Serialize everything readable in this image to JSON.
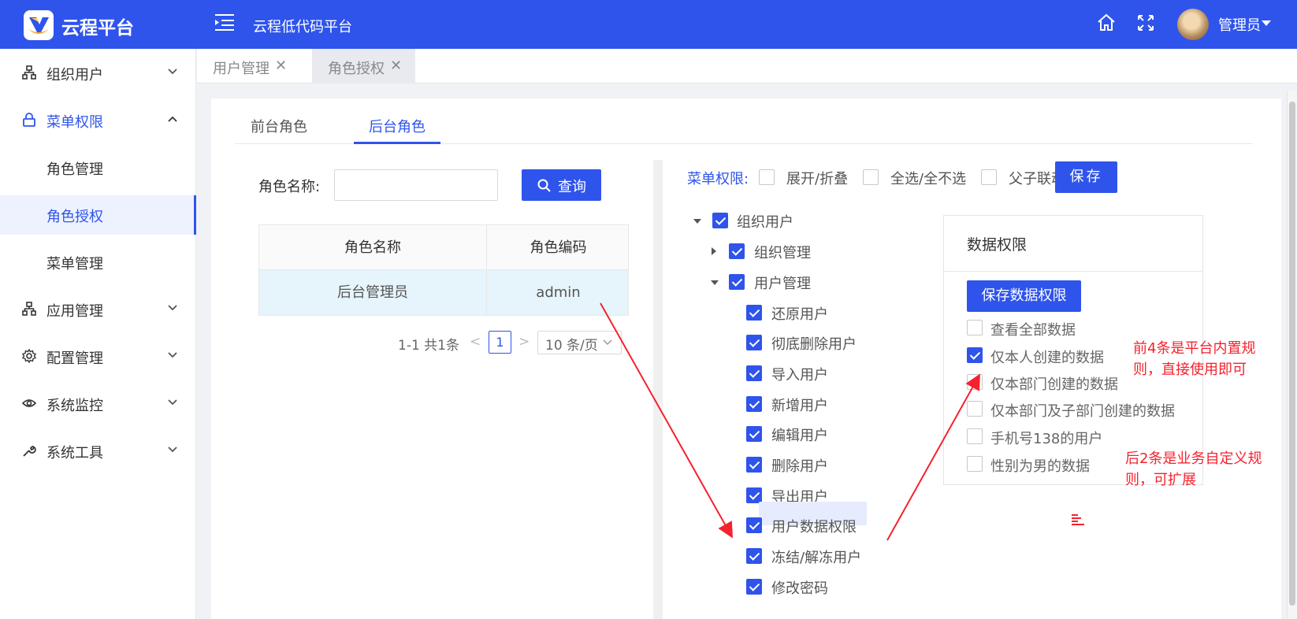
{
  "header": {
    "brand": "云程平台",
    "system_title": "云程低代码平台",
    "user_name": "管理员",
    "icons": [
      "logo-icon",
      "menu-fold-icon",
      "home-icon",
      "fullscreen-icon",
      "avatar",
      "caret-down-icon"
    ],
    "bg_color": "#2f54eb"
  },
  "sidebar": {
    "items": [
      {
        "label": "组织用户",
        "icon": "org-icon"
      },
      {
        "label": "菜单权限",
        "icon": "lock-icon"
      },
      {
        "label": "角色管理"
      },
      {
        "label": "角色授权"
      },
      {
        "label": "菜单管理"
      },
      {
        "label": "应用管理",
        "icon": "app-icon"
      },
      {
        "label": "配置管理",
        "icon": "gear-icon"
      },
      {
        "label": "系统监控",
        "icon": "eye-icon"
      },
      {
        "label": "系统工具",
        "icon": "wrench-icon"
      }
    ],
    "active_item": "角色授权"
  },
  "page_tabs": [
    {
      "label": "用户管理",
      "close": "✕"
    },
    {
      "label": "角色授权",
      "close": "✕"
    }
  ],
  "role_tabs": [
    "前台角色",
    "后台角色"
  ],
  "query": {
    "label": "角色名称:",
    "input_value": "",
    "button": "查询"
  },
  "table": {
    "columns": [
      "角色名称",
      "角色编码"
    ],
    "rows": [
      [
        "后台管理员",
        "admin"
      ]
    ]
  },
  "pagination": {
    "total": "1-1 共1条",
    "prev": "<",
    "current": "1",
    "next": ">",
    "page_size": "10 条/页"
  },
  "menu_perm": {
    "label": "菜单权限:",
    "options": [
      {
        "label": "展开/折叠",
        "checked": false
      },
      {
        "label": "全选/全不选",
        "checked": false
      },
      {
        "label": "父子联动",
        "checked": false
      }
    ],
    "save": "保存"
  },
  "tree": [
    {
      "label": "组织用户",
      "checked": true,
      "expanded": true
    },
    {
      "label": "组织管理",
      "checked": true,
      "expanded": false
    },
    {
      "label": "用户管理",
      "checked": true,
      "expanded": true
    },
    {
      "label": "还原用户",
      "checked": true
    },
    {
      "label": "彻底删除用户",
      "checked": true
    },
    {
      "label": "导入用户",
      "checked": true
    },
    {
      "label": "新增用户",
      "checked": true
    },
    {
      "label": "编辑用户",
      "checked": true
    },
    {
      "label": "删除用户",
      "checked": true
    },
    {
      "label": "导出用户",
      "checked": true
    },
    {
      "label": "用户数据权限",
      "checked": true,
      "highlighted": true
    },
    {
      "label": "冻结/解冻用户",
      "checked": true
    },
    {
      "label": "修改密码",
      "checked": true
    }
  ],
  "data_perm": {
    "title": "数据权限",
    "save_button": "保存数据权限",
    "items": [
      {
        "label": "查看全部数据",
        "checked": false
      },
      {
        "label": "仅本人创建的数据",
        "checked": true
      },
      {
        "label": "仅本部门创建的数据",
        "checked": false
      },
      {
        "label": "仅本部门及子部门创建的数据",
        "checked": false
      },
      {
        "label": "手机号138的用户",
        "checked": false
      },
      {
        "label": "性别为男的数据",
        "checked": false
      }
    ]
  },
  "notes": {
    "note1_line1": "前4条是平台内置规",
    "note1_line2": "则，直接使用即可",
    "note2_line1": "后2条是业务自定义规",
    "note2_line2": "则，可扩展"
  },
  "colors": {
    "primary": "#2f54eb",
    "annotation": "#f5222d"
  }
}
